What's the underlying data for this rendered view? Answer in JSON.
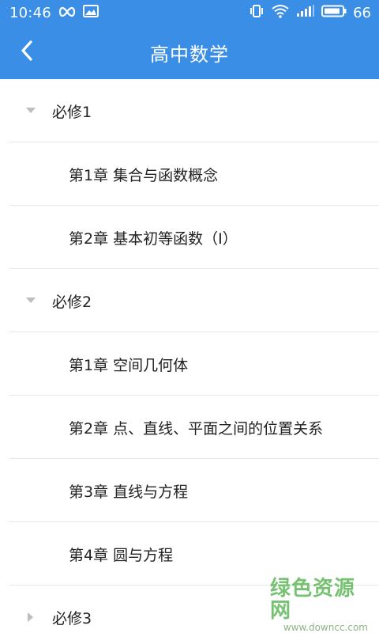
{
  "status_bar": {
    "time": "10:46",
    "battery_percent": "66",
    "icons": [
      "infinity-icon",
      "image-icon",
      "vibrate-icon",
      "wifi-icon",
      "signal-icon",
      "battery-icon"
    ]
  },
  "app_bar": {
    "title": "高中数学",
    "back_icon": "chevron-left-icon"
  },
  "colors": {
    "primary": "#3a8ee6",
    "divider": "#e8e8e8",
    "text": "#222222",
    "arrow": "#bdbdbd",
    "watermark": "#5fb85a"
  },
  "list": [
    {
      "type": "group",
      "label": "必修1",
      "expanded": true
    },
    {
      "type": "chapter",
      "label": "第1章 集合与函数概念"
    },
    {
      "type": "chapter",
      "label": "第2章 基本初等函数（Ⅰ）"
    },
    {
      "type": "group",
      "label": "必修2",
      "expanded": true
    },
    {
      "type": "chapter",
      "label": "第1章 空间几何体"
    },
    {
      "type": "chapter",
      "label": "第2章 点、直线、平面之间的位置关系"
    },
    {
      "type": "chapter",
      "label": "第3章 直线与方程"
    },
    {
      "type": "chapter",
      "label": "第4章 圆与方程"
    },
    {
      "type": "group",
      "label": "必修3",
      "expanded": false
    }
  ],
  "watermark": {
    "main": "绿色资源网",
    "sub": "www.downcc.com"
  }
}
